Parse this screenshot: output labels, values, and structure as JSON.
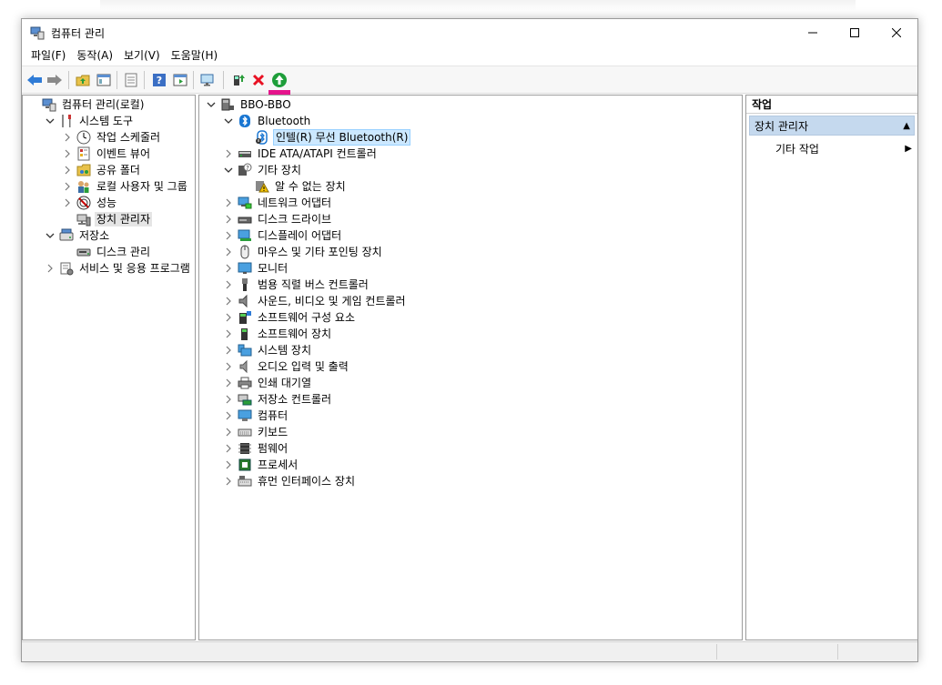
{
  "window": {
    "title": "컴퓨터 관리"
  },
  "menu": [
    "파일(F)",
    "동작(A)",
    "보기(V)",
    "도움말(H)"
  ],
  "left_tree": [
    {
      "label": "컴퓨터 관리(로컬)",
      "level": 0,
      "expander": "",
      "icon": "computer-management-icon"
    },
    {
      "label": "시스템 도구",
      "level": 1,
      "expander": "expanded",
      "icon": "tools-icon"
    },
    {
      "label": "작업 스케줄러",
      "level": 2,
      "expander": "collapsed",
      "icon": "clock-icon"
    },
    {
      "label": "이벤트 뷰어",
      "level": 2,
      "expander": "collapsed",
      "icon": "event-viewer-icon"
    },
    {
      "label": "공유 폴더",
      "level": 2,
      "expander": "collapsed",
      "icon": "shared-folder-icon"
    },
    {
      "label": "로컬 사용자 및 그룹",
      "level": 2,
      "expander": "collapsed",
      "icon": "users-icon"
    },
    {
      "label": "성능",
      "level": 2,
      "expander": "collapsed",
      "icon": "performance-icon"
    },
    {
      "label": "장치 관리자",
      "level": 2,
      "expander": "",
      "icon": "device-manager-icon",
      "selected": true
    },
    {
      "label": "저장소",
      "level": 1,
      "expander": "expanded",
      "icon": "storage-icon"
    },
    {
      "label": "디스크 관리",
      "level": 2,
      "expander": "",
      "icon": "disk-icon"
    },
    {
      "label": "서비스 및 응용 프로그램",
      "level": 1,
      "expander": "collapsed",
      "icon": "services-icon"
    }
  ],
  "device_tree": [
    {
      "label": "BBO-BBO",
      "level": 0,
      "expander": "expanded",
      "icon": "computer-icon"
    },
    {
      "label": "Bluetooth",
      "level": 1,
      "expander": "expanded",
      "icon": "bluetooth-icon"
    },
    {
      "label": "인텔(R) 무선 Bluetooth(R)",
      "level": 2,
      "expander": "",
      "icon": "bluetooth-device-warning-icon",
      "selected": true
    },
    {
      "label": "IDE ATA/ATAPI 컨트롤러",
      "level": 1,
      "expander": "collapsed",
      "icon": "ide-controller-icon"
    },
    {
      "label": "기타 장치",
      "level": 1,
      "expander": "expanded",
      "icon": "unknown-device-icon"
    },
    {
      "label": "알 수 없는 장치",
      "level": 2,
      "expander": "",
      "icon": "warning-device-icon"
    },
    {
      "label": "네트워크 어댑터",
      "level": 1,
      "expander": "collapsed",
      "icon": "network-adapter-icon"
    },
    {
      "label": "디스크 드라이브",
      "level": 1,
      "expander": "collapsed",
      "icon": "disk-drive-icon"
    },
    {
      "label": "디스플레이 어댑터",
      "level": 1,
      "expander": "collapsed",
      "icon": "display-adapter-icon"
    },
    {
      "label": "마우스 및 기타 포인팅 장치",
      "level": 1,
      "expander": "collapsed",
      "icon": "mouse-icon"
    },
    {
      "label": "모니터",
      "level": 1,
      "expander": "collapsed",
      "icon": "monitor-icon"
    },
    {
      "label": "범용 직렬 버스 컨트롤러",
      "level": 1,
      "expander": "collapsed",
      "icon": "usb-icon"
    },
    {
      "label": "사운드, 비디오 및 게임 컨트롤러",
      "level": 1,
      "expander": "collapsed",
      "icon": "speaker-icon"
    },
    {
      "label": "소프트웨어 구성 요소",
      "level": 1,
      "expander": "collapsed",
      "icon": "software-component-icon"
    },
    {
      "label": "소프트웨어 장치",
      "level": 1,
      "expander": "collapsed",
      "icon": "software-device-icon"
    },
    {
      "label": "시스템 장치",
      "level": 1,
      "expander": "collapsed",
      "icon": "system-device-icon"
    },
    {
      "label": "오디오 입력 및 출력",
      "level": 1,
      "expander": "collapsed",
      "icon": "audio-icon"
    },
    {
      "label": "인쇄 대기열",
      "level": 1,
      "expander": "collapsed",
      "icon": "printer-icon"
    },
    {
      "label": "저장소 컨트롤러",
      "level": 1,
      "expander": "collapsed",
      "icon": "storage-controller-icon"
    },
    {
      "label": "컴퓨터",
      "level": 1,
      "expander": "collapsed",
      "icon": "computer-monitor-icon"
    },
    {
      "label": "키보드",
      "level": 1,
      "expander": "collapsed",
      "icon": "keyboard-icon"
    },
    {
      "label": "펌웨어",
      "level": 1,
      "expander": "collapsed",
      "icon": "firmware-icon"
    },
    {
      "label": "프로세서",
      "level": 1,
      "expander": "collapsed",
      "icon": "processor-icon"
    },
    {
      "label": "휴먼 인터페이스 장치",
      "level": 1,
      "expander": "collapsed",
      "icon": "hid-icon"
    }
  ],
  "actions": {
    "header": "작업",
    "section": "장치 관리자",
    "item": "기타 작업"
  },
  "colors": {
    "accent_blue": "#2f7bd6",
    "delete_red": "#e81123",
    "enable_green": "#1e9e3a",
    "highlight_magenta": "#e5148c",
    "selection": "#cce8ff"
  }
}
